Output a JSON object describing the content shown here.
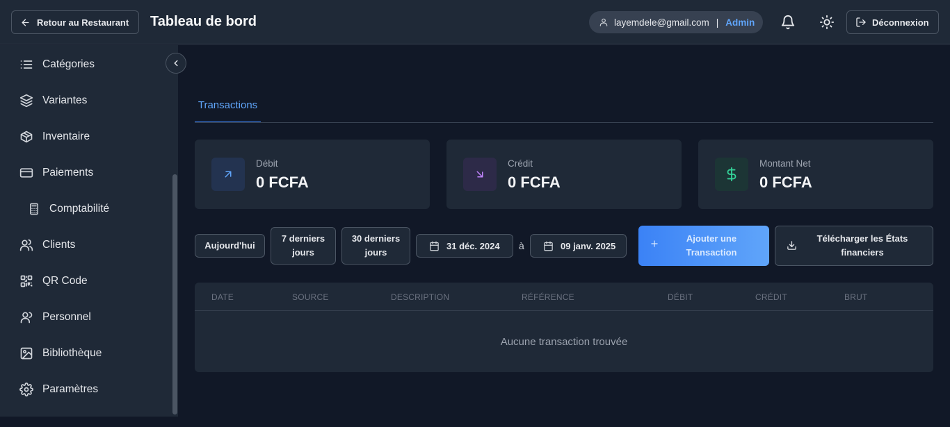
{
  "header": {
    "back_label": "Retour au Restaurant",
    "title": "Tableau de bord",
    "user_email": "layemdele@gmail.com",
    "user_separator": "|",
    "user_role": "Admin",
    "logout_label": "Déconnexion"
  },
  "sidebar": {
    "items": [
      {
        "label": "Catégories",
        "icon": "list-icon"
      },
      {
        "label": "Variantes",
        "icon": "layers-icon"
      },
      {
        "label": "Inventaire",
        "icon": "package-icon"
      },
      {
        "label": "Paiements",
        "icon": "credit-card-icon"
      },
      {
        "label": "Comptabilité",
        "icon": "calculator-icon"
      },
      {
        "label": "Clients",
        "icon": "users-icon"
      },
      {
        "label": "QR Code",
        "icon": "qr-code-icon"
      },
      {
        "label": "Personnel",
        "icon": "user-group-icon"
      },
      {
        "label": "Bibliothèque",
        "icon": "image-icon"
      },
      {
        "label": "Paramètres",
        "icon": "gear-icon"
      }
    ]
  },
  "tabs": [
    {
      "label": "Transactions",
      "active": true
    }
  ],
  "cards": [
    {
      "label": "Débit",
      "value": "0 FCFA",
      "icon": "arrow-up-right-icon",
      "color": "#60a5fa"
    },
    {
      "label": "Crédit",
      "value": "0 FCFA",
      "icon": "arrow-down-right-icon",
      "color": "#c084fc"
    },
    {
      "label": "Montant Net",
      "value": "0 FCFA",
      "icon": "dollar-icon",
      "color": "#34d399"
    }
  ],
  "filters": {
    "today": "Aujourd'hui",
    "last7_line1": "7 derniers",
    "last7_line2": "jours",
    "last30_line1": "30 derniers",
    "last30_line2": "jours",
    "start_date": "31 déc. 2024",
    "date_separator": "à",
    "end_date": "09 janv. 2025"
  },
  "actions": {
    "add_line1": "Ajouter une",
    "add_line2": "Transaction",
    "download_line1": "Télécharger les États",
    "download_line2": "financiers"
  },
  "table": {
    "columns": [
      "DATE",
      "SOURCE",
      "DESCRIPTION",
      "RÉFÉRENCE",
      "DÉBIT",
      "CRÉDIT",
      "BRUT"
    ],
    "empty_message": "Aucune transaction trouvée"
  },
  "colors": {
    "accent": "#3b82f6",
    "background": "#111827",
    "panel": "#1f2937"
  }
}
